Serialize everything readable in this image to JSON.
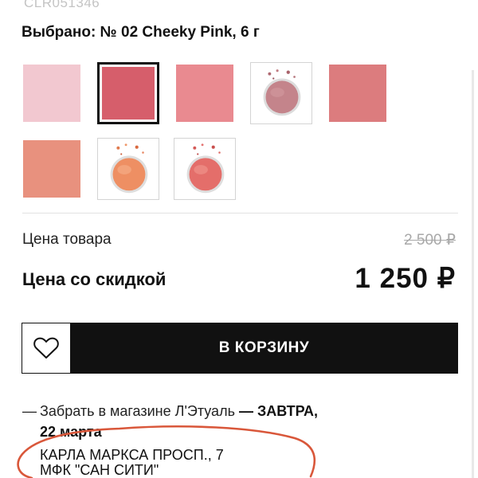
{
  "product": {
    "sku": "CLR051346",
    "selected_prefix": "Выбрано:",
    "selected_value": "№ 02 Cheeky Pink, 6 г"
  },
  "swatches": [
    {
      "kind": "flat",
      "color": "#f2c8d0",
      "selected": false
    },
    {
      "kind": "flat",
      "color": "#d65e6b",
      "selected": true
    },
    {
      "kind": "flat",
      "color": "#e98a90",
      "selected": false
    },
    {
      "kind": "product",
      "color": "#c4848b",
      "selected": false
    },
    {
      "kind": "flat",
      "color": "#dc7c7e",
      "selected": false
    },
    {
      "kind": "flat",
      "color": "#e8917e",
      "selected": false
    },
    {
      "kind": "product",
      "color": "#ee8f63",
      "selected": false
    },
    {
      "kind": "product",
      "color": "#e46e6a",
      "selected": false
    }
  ],
  "pricing": {
    "price_label": "Цена товара",
    "price_old": "2 500 ₽",
    "discount_label": "Цена со скидкой",
    "price_new": "1 250 ₽"
  },
  "actions": {
    "wishlist_icon": "heart-outline-icon",
    "cart_label": "В КОРЗИНУ"
  },
  "pickup": {
    "dash": "—",
    "text": "Забрать в магазине Л'Этуаль",
    "dash2": "—",
    "day": "ЗАВТРА,",
    "date": "22 марта"
  },
  "address": {
    "line1": "КАРЛА МАРКСА ПРОСП., 7",
    "line2": "МФК \"САН СИТИ\""
  },
  "colors": {
    "accent": "#111111",
    "annotation": "#d9573a"
  }
}
